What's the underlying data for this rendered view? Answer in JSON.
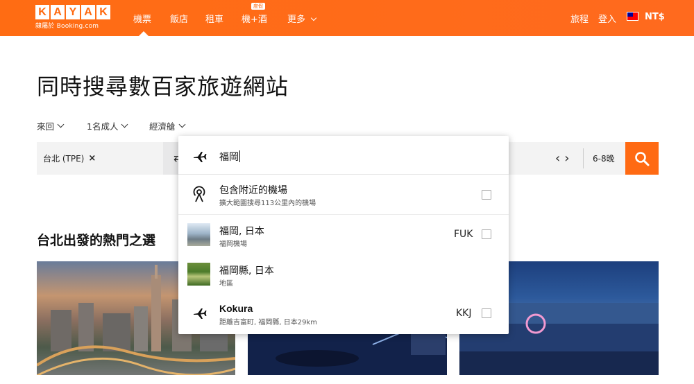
{
  "brand": {
    "logo_letters": [
      "K",
      "A",
      "Y",
      "A",
      "K"
    ],
    "tagline": "隸屬於 Booking.com",
    "accent_color": "#ff690f"
  },
  "nav": {
    "flights": "機票",
    "hotels": "飯店",
    "cars": "租車",
    "packages": "機+酒",
    "packages_badge": "度假",
    "more": "更多",
    "trips": "旅程",
    "login": "登入",
    "currency": "NT$"
  },
  "hero": {
    "title": "同時搜尋數百家旅遊網站"
  },
  "options": {
    "trip_type": "來回",
    "travelers": "1名成人",
    "cabin": "經濟艙"
  },
  "search": {
    "origin": "台北 (TPE)",
    "origin_remove": "×",
    "date_prev": "‹",
    "date_next": "›",
    "date_range": "6-8晚"
  },
  "dropdown": {
    "query": "福岡",
    "nearby_title": "包含附近的機場",
    "nearby_sub": "擴大範圍搜尋113公里內的機場",
    "results": [
      {
        "title": "福岡, 日本",
        "sub": "福岡機場",
        "code": "FUK",
        "icon": "city-thumbnail"
      },
      {
        "title": "福岡縣, 日本",
        "sub": "地區",
        "code": "",
        "icon": "forest-thumbnail"
      },
      {
        "title": "Kokura",
        "sub": "距離吉富町, 福岡縣, 日本29km",
        "code": "KKJ",
        "icon": "plane-icon"
      }
    ]
  },
  "popular": {
    "title": "台北出發的熱門之選"
  }
}
